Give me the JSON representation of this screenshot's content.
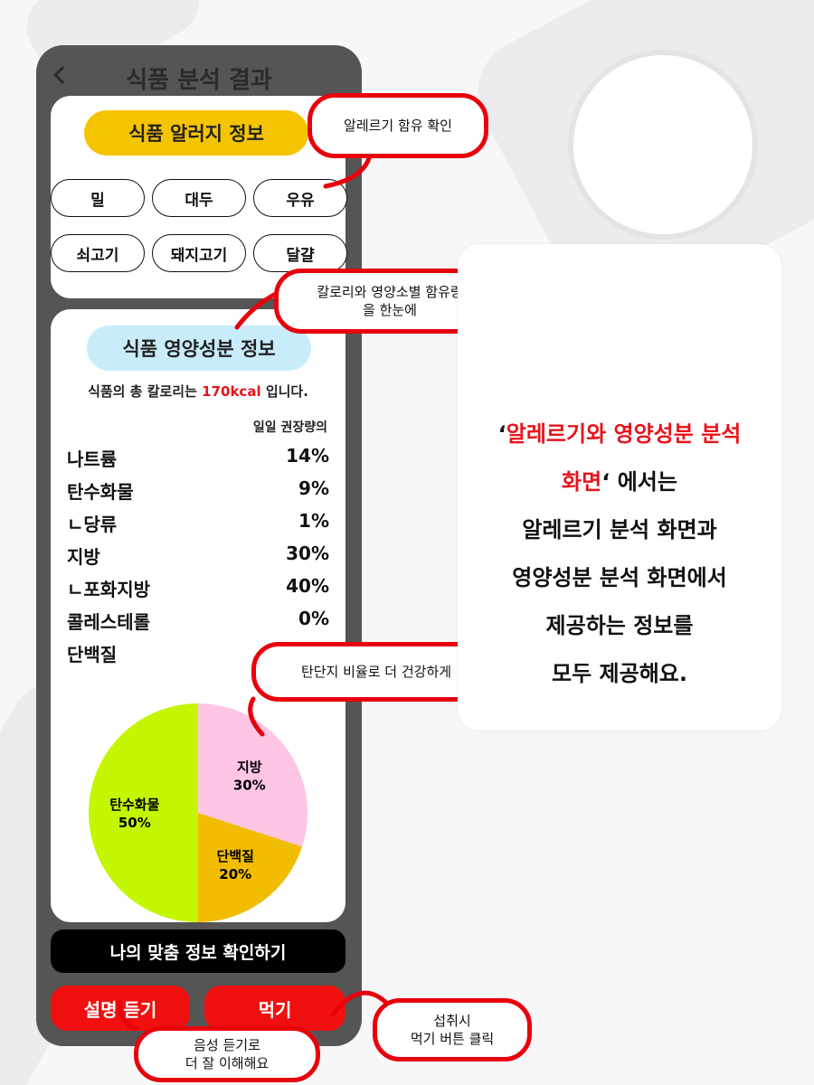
{
  "header": {
    "title": "식품 분석 결과"
  },
  "allergy": {
    "title": "식품 알러지 정보",
    "chips": [
      "밀",
      "대두",
      "우유",
      "쇠고기",
      "돼지고기",
      "달걀"
    ]
  },
  "nutrition": {
    "title": "식품 영양성분 정보",
    "calorie_prefix": "식품의 총 칼로리는 ",
    "calorie_value": "170kcal",
    "calorie_suffix": " 입니다.",
    "daily_label": "일일 권장량의",
    "rows": [
      {
        "name": "나트륨",
        "value": "14%"
      },
      {
        "name": "탄수화물",
        "value": "9%"
      },
      {
        "name": "ㄴ당류",
        "value": "1%"
      },
      {
        "name": "지방",
        "value": "30%"
      },
      {
        "name": "ㄴ포화지방",
        "value": "40%"
      },
      {
        "name": "콜레스테롤",
        "value": "0%"
      },
      {
        "name": "단백질",
        "value": ""
      }
    ]
  },
  "chart_data": {
    "type": "pie",
    "slices": [
      {
        "label": "지방",
        "value": 30,
        "display": "30%",
        "color": "#ffc5e5"
      },
      {
        "label": "단백질",
        "value": 20,
        "display": "20%",
        "color": "#f2bd00"
      },
      {
        "label": "탄수화물",
        "value": 50,
        "display": "50%",
        "color": "#c4f601"
      }
    ]
  },
  "buttons": {
    "cta": "나의 맞춤 정보 확인하기",
    "listen": "설명 듣기",
    "eat": "먹기"
  },
  "callouts": {
    "allergy": "알레르기 함유 확인",
    "nutrition_line1": "칼로리와 영양소별 함유량",
    "nutrition_line2": "을 한눈에",
    "ratio": "탄단지 비율로 더 건강하게",
    "listen_line1": "음성 듣기로",
    "listen_line2": "더 잘 이해해요",
    "eat_line1": "섭취시",
    "eat_line2": "먹기 버튼 클릭"
  },
  "info": {
    "quote_open": "‘",
    "highlight_line1": "알레르기와 영양성분 분석",
    "highlight_line2": "화면",
    "quote_close": "‘ 에서는",
    "line3": "알레르기 분석 화면과",
    "line4": "영양성분 분석 화면에서",
    "line5": "제공하는 정보를",
    "line6": "모두 제공해요."
  },
  "colors": {
    "accent_red": "#e8131b",
    "allergy_yellow": "#f5c400",
    "nutrition_blue": "#c8ecf9",
    "phone_frame": "#555555"
  }
}
